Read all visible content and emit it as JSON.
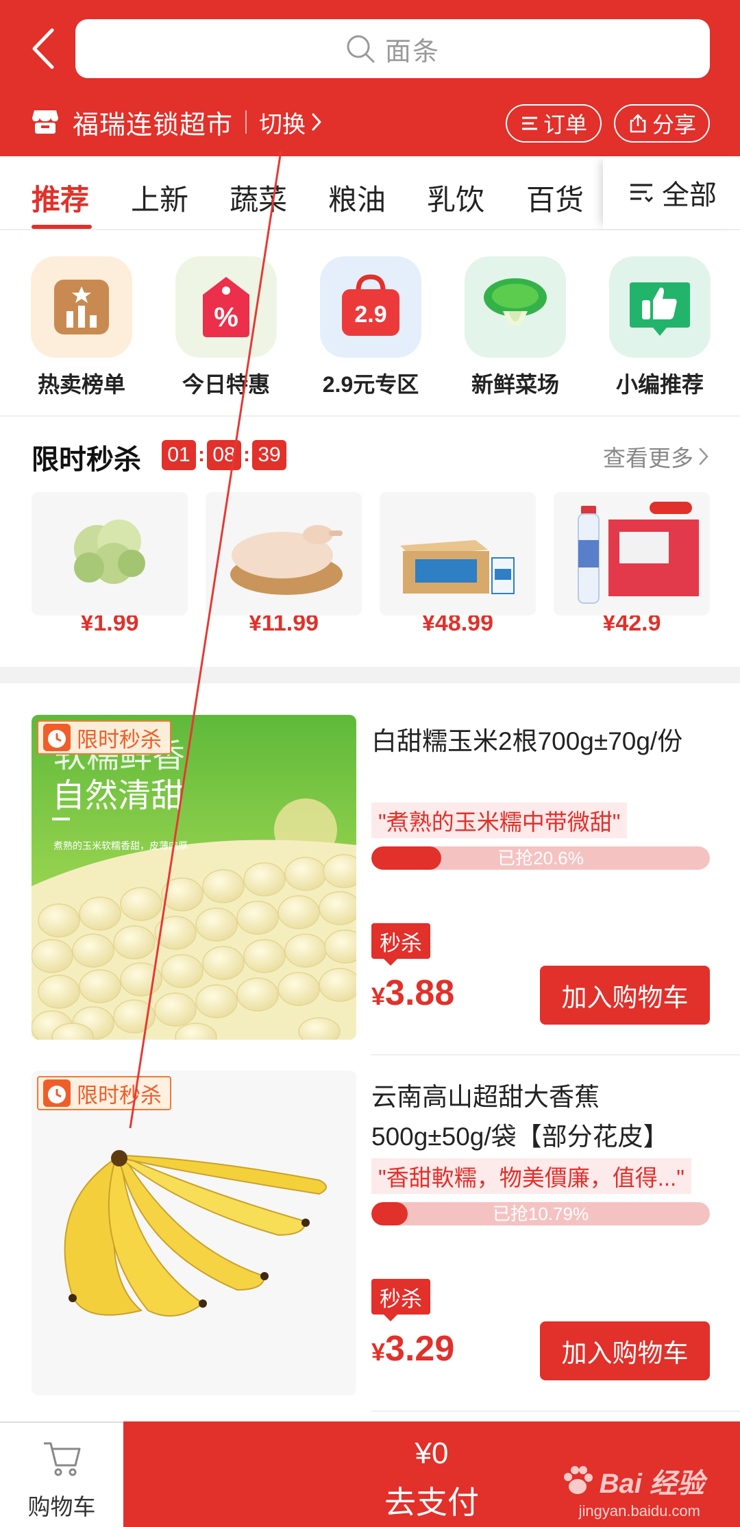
{
  "header": {
    "search_placeholder": "面条",
    "store_name": "福瑞连锁超市",
    "switch_label": "切换",
    "orders_label": "订单",
    "share_label": "分享"
  },
  "tabs": [
    "推荐",
    "上新",
    "蔬菜",
    "粮油",
    "乳饮",
    "百货"
  ],
  "all_tab_label": "全部",
  "quick_entries": [
    "热卖榜单",
    "今日特惠",
    "2.9元专区",
    "新鲜菜场",
    "小编推荐"
  ],
  "quick_icon_texts": {
    "discount": "%",
    "zone_29": "2.9"
  },
  "flash_sale": {
    "title": "限时秒杀",
    "timer": {
      "hours": "01",
      "minutes": "08",
      "seconds": "39"
    },
    "more_label": "查看更多",
    "items": [
      {
        "name": "cauliflower",
        "price": "¥1.99"
      },
      {
        "name": "duck",
        "price": "¥11.99"
      },
      {
        "name": "milk-box",
        "price": "¥48.99"
      },
      {
        "name": "soda-water",
        "price": "¥42.9"
      }
    ]
  },
  "products": [
    {
      "badge": "限时秒杀",
      "image_text_1": "软糯鲜香",
      "image_text_2": "自然清甜",
      "image_text_3": "煮熟的玉米软糯香甜，皮薄肉厚",
      "title": "白甜糯玉米2根700g±70g/份",
      "tag": "\"煮熟的玉米糯中带微甜\"",
      "progress_text": "已抢20.6%",
      "progress": 0.206,
      "seckill_label": "秒杀",
      "currency": "¥",
      "price": "3.88",
      "button": "加入购物车"
    },
    {
      "badge": "限时秒杀",
      "title": "云南高山超甜大香蕉500g±50g/袋【部分花皮】",
      "tag": "\"香甜軟糯，物美價廉，值得...\"",
      "progress_text": "已抢10.79%",
      "progress": 0.1079,
      "seckill_label": "秒杀",
      "currency": "¥",
      "price": "3.29",
      "button": "加入购物车"
    }
  ],
  "bottom_bar": {
    "cart_label": "购物车",
    "total": "¥0",
    "pay_label": "去支付",
    "watermark": "Bai 经验",
    "watermark_sub": "jingyan.baidu.com"
  },
  "colors": {
    "brand_red": "#e2302a",
    "annotation_red": "#e53935"
  }
}
